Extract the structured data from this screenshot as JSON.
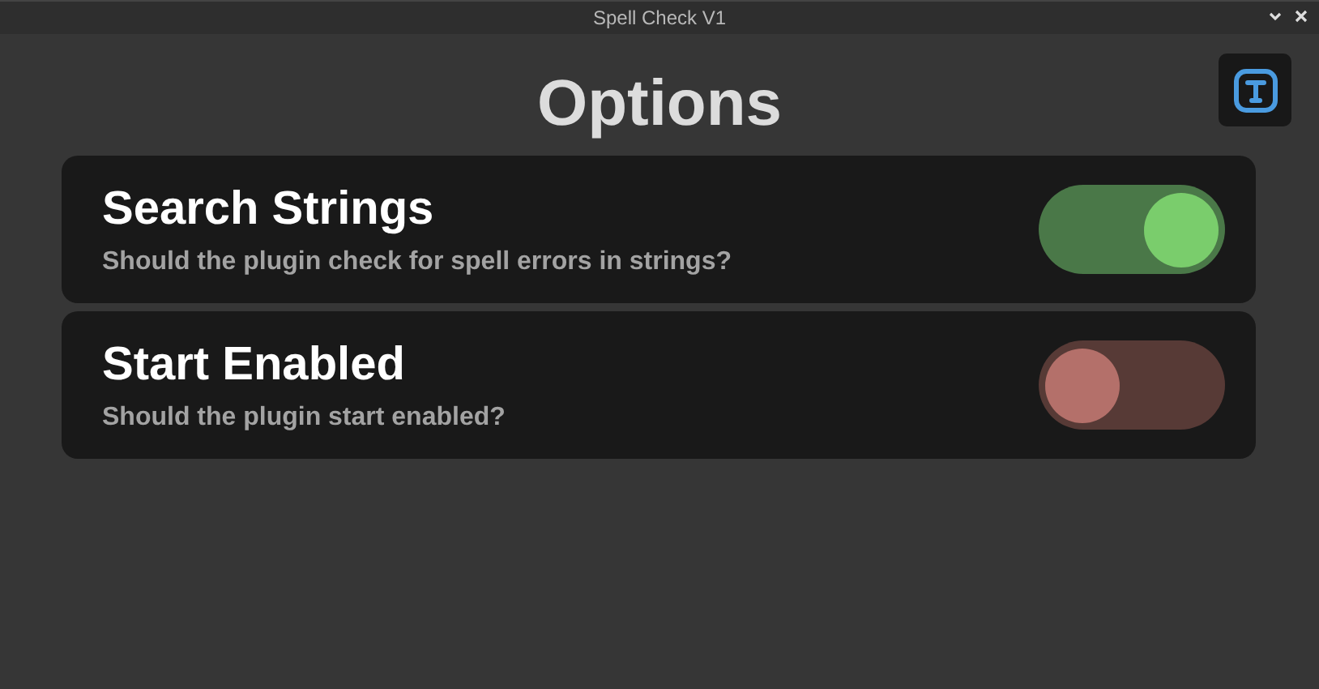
{
  "window": {
    "title": "Spell Check V1"
  },
  "heading": "Options",
  "options": [
    {
      "title": "Search Strings",
      "description": "Should the plugin check for spell errors in strings?",
      "on": true
    },
    {
      "title": "Start Enabled",
      "description": "Should the plugin start enabled?",
      "on": false
    }
  ]
}
